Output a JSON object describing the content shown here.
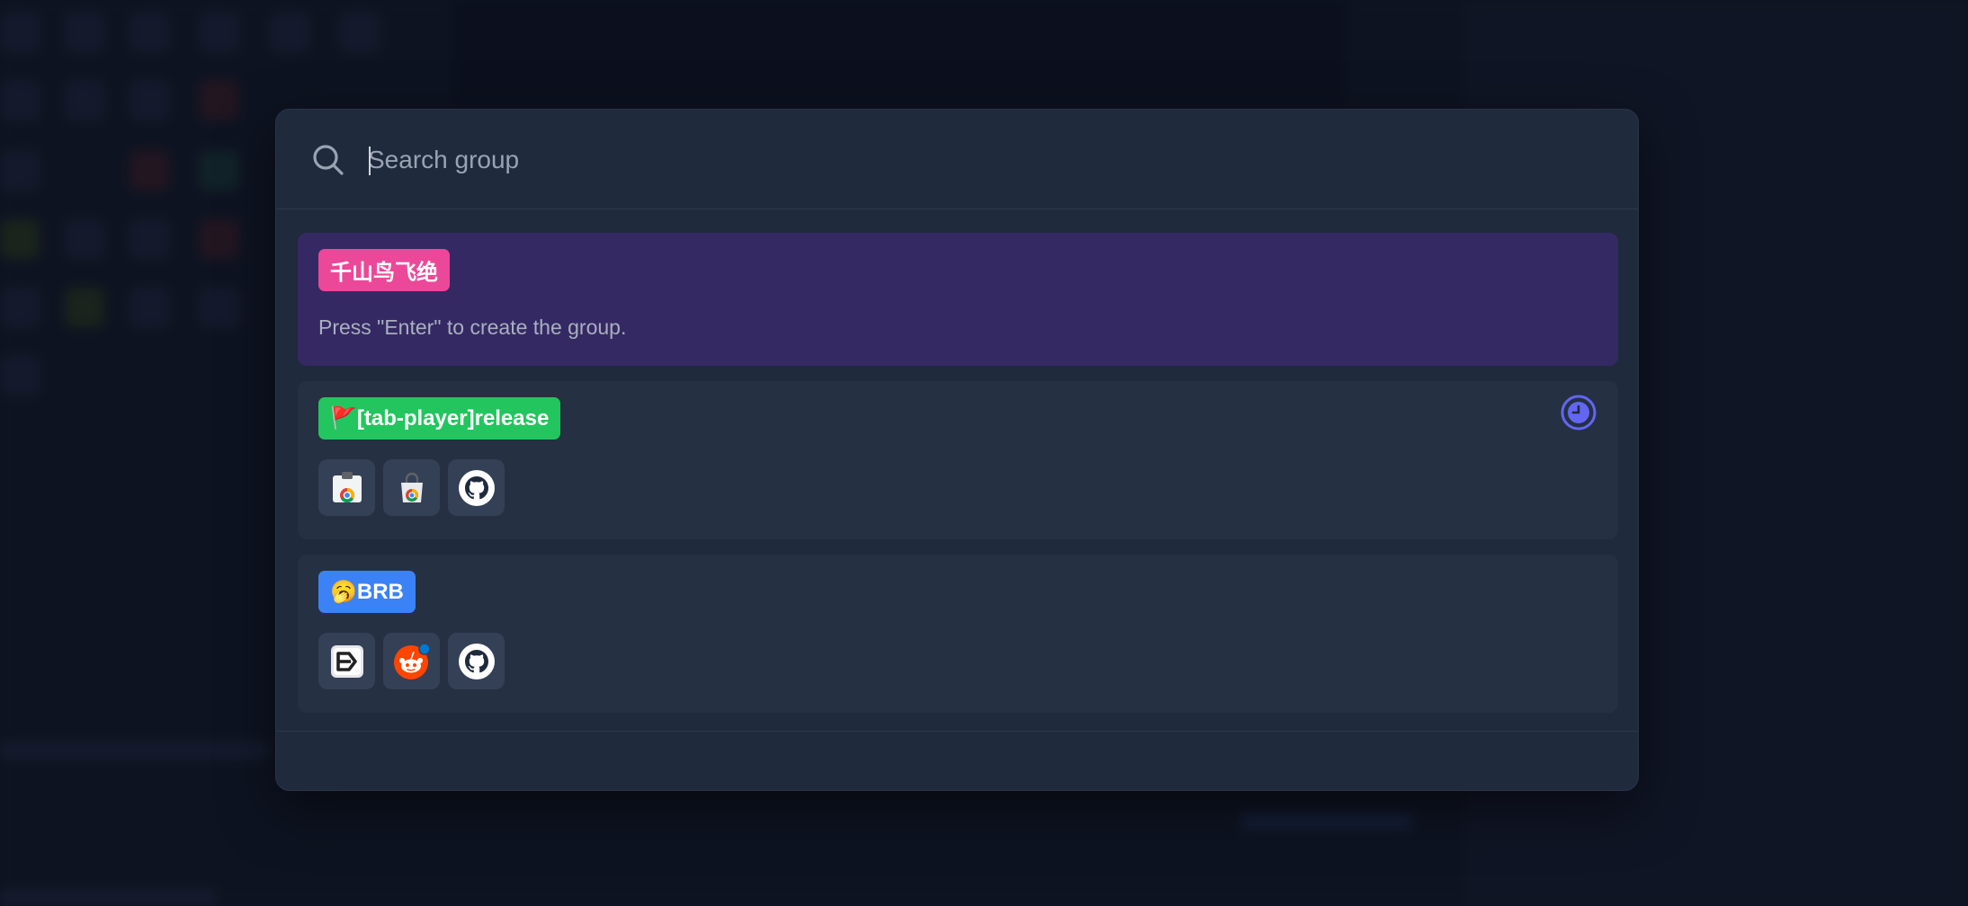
{
  "search": {
    "placeholder": "Search group",
    "value": ""
  },
  "new_group": {
    "name": "千山鸟飞绝",
    "color": "#ec4899",
    "hint": "Press \"Enter\" to create the group."
  },
  "groups": [
    {
      "name": "🚩[tab-player]release",
      "color": "#22c55e",
      "has_clock": true,
      "favicons": [
        "chrome-web-store-icon",
        "chrome-web-store-bag-icon",
        "github-icon"
      ]
    },
    {
      "name": "🥱BRB",
      "color": "#3b82f6",
      "has_clock": false,
      "favicons": [
        "exit-arrow-icon",
        "reddit-icon",
        "github-icon"
      ]
    }
  ],
  "colors": {
    "dialog": "#1f2a3c",
    "create_card": "#352964",
    "group_card": "#253043",
    "accent": "#6366f1"
  }
}
